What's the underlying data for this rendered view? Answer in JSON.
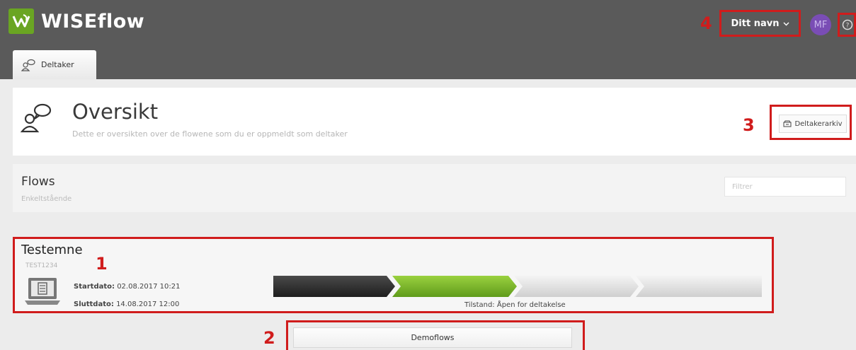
{
  "app": {
    "logo_text": "WISEflow",
    "brand_color": "#6aa522",
    "annotation_color": "#d01c1c"
  },
  "header": {
    "user_name": "Ditt navn",
    "avatar_initials": "MF",
    "avatar_color": "#7a4db5"
  },
  "tabs": [
    {
      "label": "Deltaker",
      "icon": "participant-icon",
      "active": true
    }
  ],
  "overview": {
    "title": "Oversikt",
    "subtitle": "Dette er oversikten over de flowene som du er oppmeldt som deltaker",
    "archive_button": "Deltakerarkiv"
  },
  "flows": {
    "title": "Flows",
    "subtitle": "Enkeltstående",
    "filter_placeholder": "Filtrer"
  },
  "flow_item": {
    "title": "Testemne",
    "code": "TEST1234",
    "start_label": "Startdato:",
    "start_value": "02.08.2017 10:21",
    "end_label": "Sluttdato:",
    "end_value": "14.08.2017 12:00",
    "state": "Tilstand: Åpen for deltakelse",
    "progress_steps": [
      {
        "status": "done",
        "color": "#2b2b2b"
      },
      {
        "status": "current",
        "color": "#7ab62a"
      },
      {
        "status": "pending",
        "color": "#dcdcdc"
      },
      {
        "status": "pending",
        "color": "#dcdcdc"
      }
    ]
  },
  "demo_button": "Demoflows",
  "annotations": [
    "1",
    "2",
    "3",
    "4"
  ]
}
